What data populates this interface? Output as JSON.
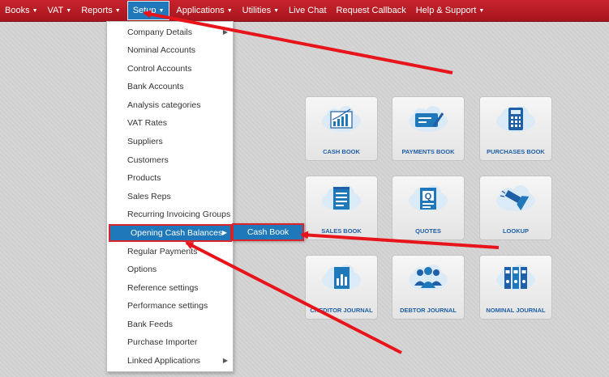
{
  "navbar": {
    "items": [
      {
        "label": "Books",
        "caret": "▼"
      },
      {
        "label": "VAT",
        "caret": "▼"
      },
      {
        "label": "Reports",
        "caret": "▼"
      },
      {
        "label": "Setup",
        "caret": "▼"
      },
      {
        "label": "Applications",
        "caret": "▼"
      },
      {
        "label": "Utilities",
        "caret": "▼"
      },
      {
        "label": "Live Chat",
        "caret": ""
      },
      {
        "label": "Request Callback",
        "caret": ""
      },
      {
        "label": "Help & Support",
        "caret": "▼"
      }
    ]
  },
  "setup_menu": {
    "items": [
      {
        "label": "Company Details",
        "submenu_arrow": "▶"
      },
      {
        "label": "Nominal Accounts"
      },
      {
        "label": "Control Accounts"
      },
      {
        "label": "Bank Accounts"
      },
      {
        "label": "Analysis categories"
      },
      {
        "label": "VAT Rates"
      },
      {
        "label": "Suppliers"
      },
      {
        "label": "Customers"
      },
      {
        "label": "Products"
      },
      {
        "label": "Sales Reps"
      },
      {
        "label": "Recurring Invoicing Groups"
      },
      {
        "label": "Opening Cash Balances",
        "submenu_arrow": "▶"
      },
      {
        "label": "Regular Payments"
      },
      {
        "label": "Options"
      },
      {
        "label": "Reference settings"
      },
      {
        "label": "Performance settings"
      },
      {
        "label": "Bank Feeds"
      },
      {
        "label": "Purchase Importer"
      },
      {
        "label": "Linked Applications",
        "submenu_arrow": "▶"
      }
    ]
  },
  "submenu": {
    "label": "Cash Book"
  },
  "tiles": [
    {
      "label": "CASH BOOK",
      "icon": "bar-chart-icon"
    },
    {
      "label": "PAYMENTS BOOK",
      "icon": "payment-card-icon"
    },
    {
      "label": "PURCHASES BOOK",
      "icon": "calculator-icon"
    },
    {
      "label": "SALES BOOK",
      "icon": "notepad-icon"
    },
    {
      "label": "QUOTES",
      "icon": "quote-document-icon"
    },
    {
      "label": "LOOKUP",
      "icon": "flashlight-icon"
    },
    {
      "label": "CREDITOR JOURNAL",
      "icon": "document-chart-icon"
    },
    {
      "label": "DEBTOR JOURNAL",
      "icon": "people-group-icon"
    },
    {
      "label": "NOMINAL JOURNAL",
      "icon": "binders-icon"
    }
  ],
  "colors": {
    "navbar": "#b81c24",
    "active": "#1f78b9",
    "tile_text": "#1f5fa8",
    "annotation_arrow": "#e8141b"
  }
}
